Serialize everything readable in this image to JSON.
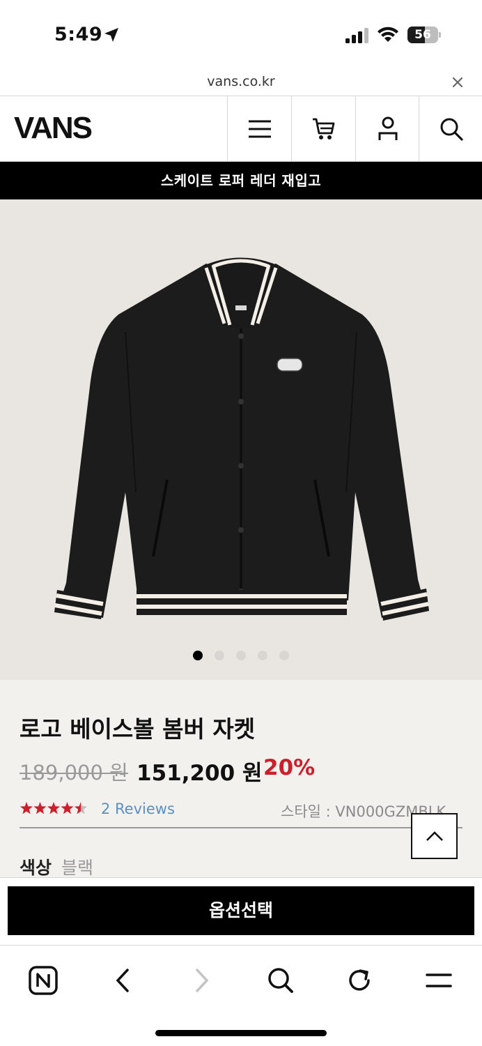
{
  "status_bar": {
    "time": "5:49",
    "battery_percent": 56,
    "battery_label": "56",
    "icons": [
      "location-arrow-icon",
      "cellular-signal-icon",
      "wifi-icon",
      "battery-icon"
    ]
  },
  "browser": {
    "url": "vans.co.kr",
    "close_icon": "close-icon"
  },
  "header": {
    "logo_text": "VANS",
    "icons": [
      "menu-icon",
      "cart-icon",
      "account-icon",
      "search-icon"
    ]
  },
  "promo_banner": {
    "text": "스케이트 로퍼 레더 재입고"
  },
  "product": {
    "image_alt": "black varsity bomber jacket",
    "carousel": {
      "total": 5,
      "active_index": 0
    },
    "title": "로고 베이스볼 봄버 자켓",
    "original_price": "189,000 원",
    "sale_price": "151,200 원",
    "discount": "20%",
    "rating": 4.5,
    "rating_max": 5,
    "reviews_label": "2 Reviews",
    "style_label": "스타일 : VN000GZMBLK",
    "color_label": "색상",
    "color_value": "블랙",
    "option_button": "옵션선택"
  },
  "colors": {
    "accent_red": "#cc1e2b",
    "review_link": "#5c8fbf",
    "info_bg": "#f2f1ee",
    "image_bg": "#e9e6e1"
  },
  "toolbar": {
    "icons": [
      "naver-home-icon",
      "back-arrow-icon",
      "forward-arrow-icon",
      "search-icon",
      "refresh-icon",
      "menu-icon"
    ]
  }
}
